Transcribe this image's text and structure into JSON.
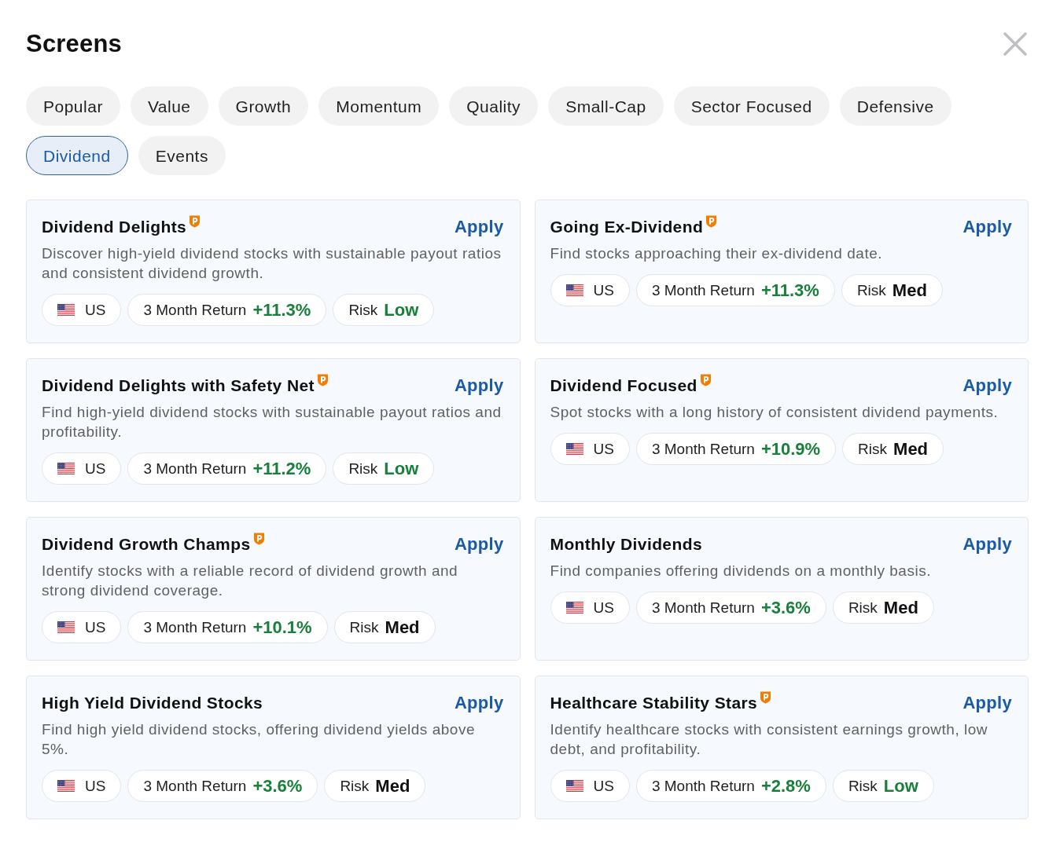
{
  "dialog": {
    "title": "Screens"
  },
  "tabs": [
    {
      "label": "Popular",
      "selected": false
    },
    {
      "label": "Value",
      "selected": false
    },
    {
      "label": "Growth",
      "selected": false
    },
    {
      "label": "Momentum",
      "selected": false
    },
    {
      "label": "Quality",
      "selected": false
    },
    {
      "label": "Small-Cap",
      "selected": false
    },
    {
      "label": "Sector Focused",
      "selected": false
    },
    {
      "label": "Defensive",
      "selected": false
    },
    {
      "label": "Dividend",
      "selected": true
    },
    {
      "label": "Events",
      "selected": false
    }
  ],
  "cards": [
    {
      "title": "Dividend Delights",
      "premium": true,
      "action": "Apply",
      "description": "Discover high-yield dividend stocks with sustainable payout ratios and consistent dividend growth.",
      "region": "US",
      "return_label": "3 Month Return",
      "return_value": "+11.3%",
      "risk": {
        "label": "Risk",
        "value": "Low",
        "color": "#18803b"
      }
    },
    {
      "title": "Going Ex-Dividend",
      "premium": true,
      "action": "Apply",
      "description": "Find stocks approaching their ex-dividend date.",
      "region": "US",
      "return_label": "3 Month Return",
      "return_value": "+11.3%",
      "risk": {
        "label": "Risk",
        "value": "Med",
        "color": "#111111"
      }
    },
    {
      "title": "Dividend Delights with Safety Net",
      "premium": true,
      "action": "Apply",
      "description": "Find high-yield dividend stocks with sustainable payout ratios and profitability.",
      "region": "US",
      "return_label": "3 Month Return",
      "return_value": "+11.2%",
      "risk": {
        "label": "Risk",
        "value": "Low",
        "color": "#18803b"
      }
    },
    {
      "title": "Dividend Focused",
      "premium": true,
      "action": "Apply",
      "description": "Spot stocks with a long history of consistent dividend payments.",
      "region": "US",
      "return_label": "3 Month Return",
      "return_value": "+10.9%",
      "risk": {
        "label": "Risk",
        "value": "Med",
        "color": "#111111"
      }
    },
    {
      "title": "Dividend Growth Champs",
      "premium": true,
      "action": "Apply",
      "description": "Identify stocks with a reliable record of dividend growth and strong dividend coverage.",
      "region": "US",
      "return_label": "3 Month Return",
      "return_value": "+10.1%",
      "risk": {
        "label": "Risk",
        "value": "Med",
        "color": "#111111"
      }
    },
    {
      "title": "Monthly Dividends",
      "premium": false,
      "action": "Apply",
      "description": "Find companies offering dividends on a monthly basis.",
      "region": "US",
      "return_label": "3 Month Return",
      "return_value": "+3.6%",
      "risk": {
        "label": "Risk",
        "value": "Med",
        "color": "#111111"
      }
    },
    {
      "title": "High Yield Dividend Stocks",
      "premium": false,
      "action": "Apply",
      "description": "Find high yield dividend stocks, offering dividend yields above 5%.",
      "region": "US",
      "return_label": "3 Month Return",
      "return_value": "+3.6%",
      "risk": {
        "label": "Risk",
        "value": "Med",
        "color": "#111111"
      }
    },
    {
      "title": "Healthcare Stability Stars",
      "premium": true,
      "action": "Apply",
      "description": "Identify healthcare stocks with consistent earnings growth, low debt, and profitability.",
      "region": "US",
      "return_label": "3 Month Return",
      "return_value": "+2.8%",
      "risk": {
        "label": "Risk",
        "value": "Low",
        "color": "#18803b"
      }
    }
  ]
}
